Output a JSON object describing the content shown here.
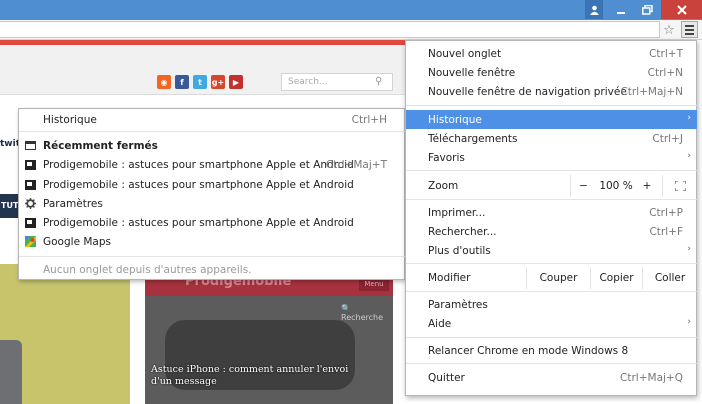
{
  "submenu": {
    "header": {
      "label": "Historique",
      "shortcut": "Ctrl+H"
    },
    "recent_title": "Récemment fermés",
    "items": [
      {
        "label": "Prodigemobile : astuces pour smartphone Apple et Android",
        "shortcut": "Ctrl+Maj+T",
        "icon": "page-thumbnail-icon"
      },
      {
        "label": "Prodigemobile : astuces pour smartphone Apple et Android",
        "shortcut": "",
        "icon": "page-thumbnail-icon"
      },
      {
        "label": "Paramètres",
        "shortcut": "",
        "icon": "gear-icon"
      },
      {
        "label": "Prodigemobile : astuces pour smartphone Apple et Android",
        "shortcut": "",
        "icon": "page-thumbnail-icon"
      },
      {
        "label": "Google Maps",
        "shortcut": "",
        "icon": "google-maps-icon"
      }
    ],
    "empty_note": "Aucun onglet depuis d'autres appareils."
  },
  "menu": {
    "new_tab": {
      "label": "Nouvel onglet",
      "shortcut": "Ctrl+T"
    },
    "new_window": {
      "label": "Nouvelle fenêtre",
      "shortcut": "Ctrl+N"
    },
    "incognito": {
      "label": "Nouvelle fenêtre de navigation privée",
      "shortcut": "Ctrl+Maj+N"
    },
    "history": {
      "label": "Historique"
    },
    "downloads": {
      "label": "Téléchargements",
      "shortcut": "Ctrl+J"
    },
    "bookmarks": {
      "label": "Favoris"
    },
    "zoom": {
      "label": "Zoom",
      "minus": "−",
      "value": "100 %",
      "plus": "+"
    },
    "print": {
      "label": "Imprimer...",
      "shortcut": "Ctrl+P"
    },
    "find": {
      "label": "Rechercher...",
      "shortcut": "Ctrl+F"
    },
    "more_tools": {
      "label": "Plus d'outils"
    },
    "edit": {
      "label": "Modifier",
      "cut": "Couper",
      "copy": "Copier",
      "paste": "Coller"
    },
    "settings": {
      "label": "Paramètres"
    },
    "help": {
      "label": "Aide"
    },
    "relaunch": {
      "label": "Relancer Chrome en mode Windows 8"
    },
    "quit": {
      "label": "Quitter",
      "shortcut": "Ctrl+Maj+Q"
    }
  },
  "site": {
    "search_placeholder": "Search...",
    "social": {
      "rss": "◉",
      "facebook": "f",
      "twitter": "t",
      "google_plus": "g+",
      "youtube": "▶"
    },
    "left_strip_text": "twit",
    "dark_strip_text": "TUT",
    "article": {
      "brand": "Prodigemobile",
      "menu": "Menu",
      "search": "🔍 Recherche",
      "title": "Astuce iPhone : comment annuler l'envoi d'un message"
    }
  },
  "colors": {
    "highlight": "#4d90e5",
    "titlebar": "#4f8fd1",
    "close": "#c9423b"
  }
}
